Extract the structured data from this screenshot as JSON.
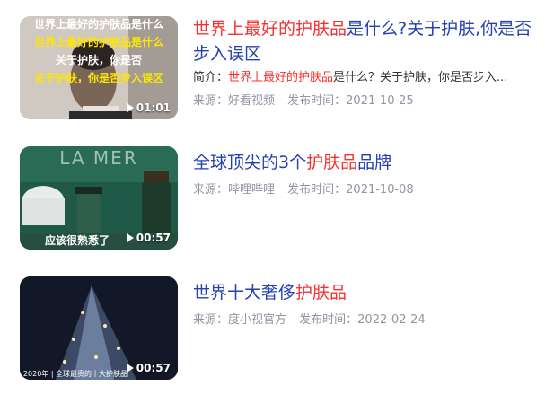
{
  "results": [
    {
      "title_parts": [
        {
          "text": "世界上最好的护肤品",
          "hl": true
        },
        {
          "text": "是什么?关于护肤,你是否步入误区",
          "hl": false
        }
      ],
      "snippet": {
        "prefix": "简介：",
        "parts": [
          {
            "text": "世界上最好的护肤品",
            "hl": true
          },
          {
            "text": "是什么？关于护肤，你是否步入...",
            "hl": false
          }
        ]
      },
      "source_label": "来源：好看视频",
      "date_label": "发布时间：2021-10-25",
      "duration": "01:01",
      "thumb_overlay": [
        "世界上最好的护肤品是什么",
        "世界上最好的护肤品是什么",
        "关于护肤，你是否",
        "关于护肤，你是否步入误区"
      ]
    },
    {
      "title_parts": [
        {
          "text": "全球顶尖的3个",
          "hl": false
        },
        {
          "text": "护肤品",
          "hl": true
        },
        {
          "text": "品牌",
          "hl": false
        }
      ],
      "source_label": "来源：哔哩哔哩",
      "date_label": "发布时间：2021-10-08",
      "duration": "00:57",
      "thumb_text": {
        "brand": "LA MER",
        "caption": "应该很熟悉了"
      }
    },
    {
      "title_parts": [
        {
          "text": "世界十大奢侈",
          "hl": false
        },
        {
          "text": "护肤品",
          "hl": true
        }
      ],
      "source_label": "来源：度小视官方",
      "date_label": "发布时间：2022-02-24",
      "duration": "00:57",
      "thumb_text": {
        "caption": "2020年 | 全球最贵的十大护肤品"
      }
    }
  ],
  "icons": {
    "play": "play-icon"
  },
  "colors": {
    "title": "#2440b3",
    "highlight": "#f73131",
    "meta": "#9195a3"
  }
}
